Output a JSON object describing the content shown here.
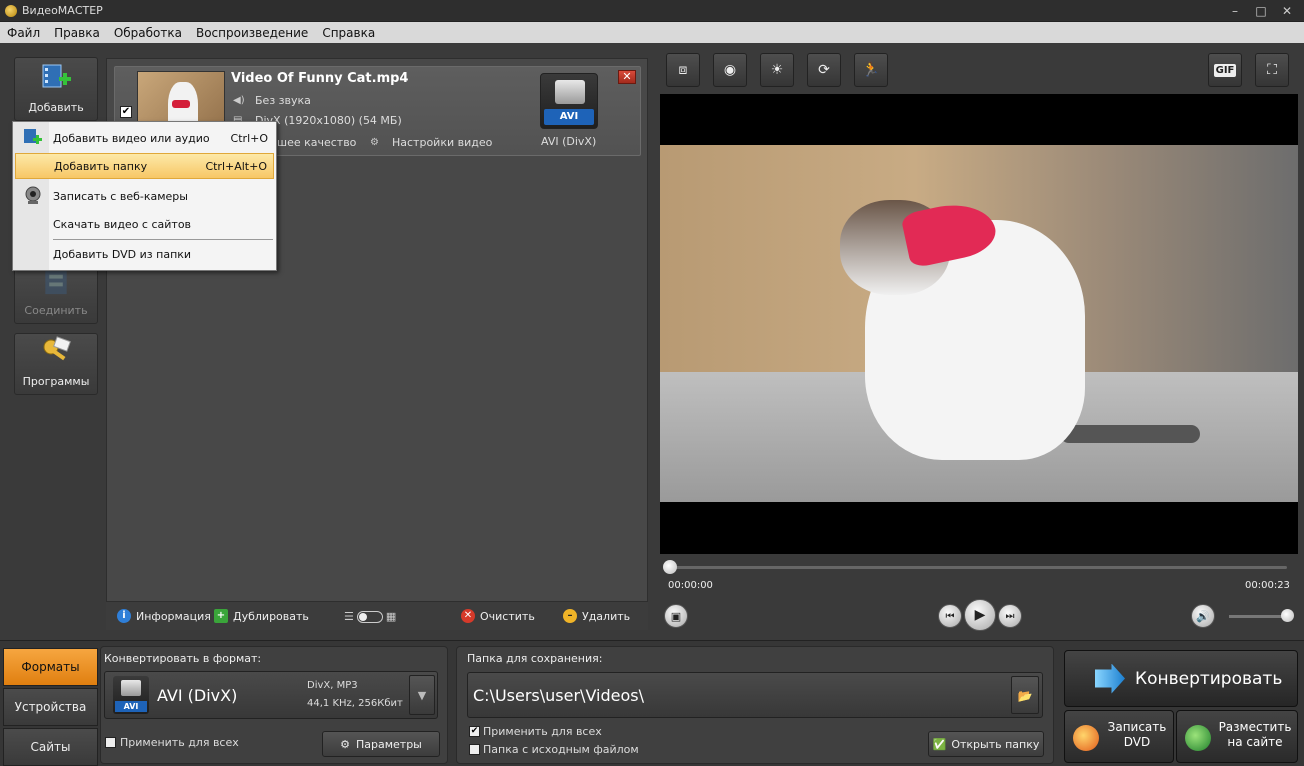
{
  "window": {
    "title": "ВидеоМАСТЕР",
    "minimize": "–",
    "maximize": "□",
    "close": "✕"
  },
  "menu": [
    "Файл",
    "Правка",
    "Обработка",
    "Воспроизведение",
    "Справка"
  ],
  "left_toolbar": {
    "add": "Добавить",
    "join": "Соединить",
    "programs": "Программы"
  },
  "file_item": {
    "name": "Video Of Funny Cat.mp4",
    "audio": "Без звука",
    "video_info": "DivX (1920x1080) (54 МБ)",
    "quality": "шее качество",
    "settings": "Настройки видео",
    "format_badge": "AVI",
    "format_caption": "AVI (DivX)",
    "checked": "✔"
  },
  "dropdown": [
    {
      "label": "Добавить видео или аудио",
      "shortcut": "Ctrl+O"
    },
    {
      "label": "Добавить папку",
      "shortcut": "Ctrl+Alt+O"
    },
    {
      "label": "Записать с веб-камеры",
      "shortcut": ""
    },
    {
      "label": "Скачать видео с сайтов",
      "shortcut": ""
    },
    {
      "label": "Добавить DVD из папки",
      "shortcut": ""
    }
  ],
  "list_toolbar": {
    "info": "Информация",
    "duplicate": "Дублировать",
    "clear": "Очистить",
    "delete": "Удалить"
  },
  "preview": {
    "gif": "GIF",
    "time_current": "00:00:00",
    "time_total": "00:00:23",
    "progress": 0,
    "volume": 1.0
  },
  "bottom": {
    "tabs": [
      "Форматы",
      "Устройства",
      "Сайты"
    ],
    "active_tab": "Форматы",
    "convert_to_label": "Конвертировать в формат:",
    "format_name": "AVI (DivX)",
    "format_badge": "AVI",
    "format_codec": "DivX, MP3",
    "format_audio": "44,1 KHz, 256Кбит",
    "apply_all": "Применить для всех",
    "params": "Параметры",
    "save_folder_label": "Папка для сохранения:",
    "save_path": "C:\\Users\\user\\Videos\\",
    "apply_all_2": "Применить для всех",
    "source_folder": "Папка с исходным файлом",
    "open_folder": "Открыть папку",
    "convert": "Конвертировать",
    "burn_dvd": "Записать DVD",
    "publish": "Разместить на сайте"
  },
  "colors": {
    "accent_orange": "#f0961f",
    "selection_yellow": "#f7c766",
    "avi_blue": "#1e63b8"
  }
}
